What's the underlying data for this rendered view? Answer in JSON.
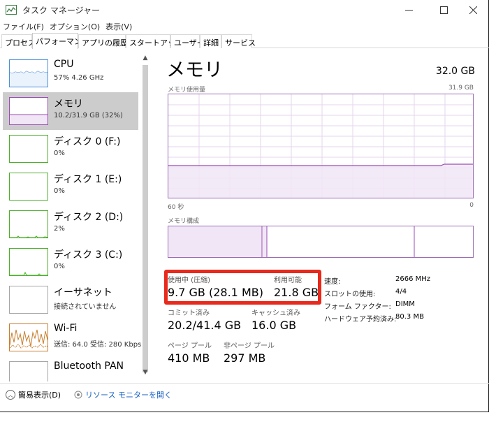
{
  "title_bar": {
    "title": "タスク マネージャー"
  },
  "menu": [
    "ファイル(F)",
    "オプション(O)",
    "表示(V)"
  ],
  "tabs": [
    "プロセス",
    "パフォーマンス",
    "アプリの履歴",
    "スタートアップ",
    "ユーザー",
    "詳細",
    "サービス"
  ],
  "active_tab": "パフォーマンス",
  "sidebar": {
    "items": [
      {
        "name": "CPU",
        "sub": "57%  4.26 GHz",
        "color": "#4a90d9"
      },
      {
        "name": "メモリ",
        "sub": "10.2/31.9 GB (32%)",
        "color": "#9b4db5"
      },
      {
        "name": "ディスク 0 (F:)",
        "sub": "0%",
        "color": "#4caf2a"
      },
      {
        "name": "ディスク 1 (E:)",
        "sub": "0%",
        "color": "#4caf2a"
      },
      {
        "name": "ディスク 2 (D:)",
        "sub": "2%",
        "color": "#4caf2a"
      },
      {
        "name": "ディスク 3 (C:)",
        "sub": "0%",
        "color": "#4caf2a"
      },
      {
        "name": "イーサネット",
        "sub": "接続されていません",
        "color": "#a6a6a6"
      },
      {
        "name": "Wi-Fi",
        "sub": "送信: 64.0  受信: 280 Kbps",
        "color": "#c87e2e"
      },
      {
        "name": "Bluetooth PAN",
        "sub": "",
        "color": "#a6a6a6"
      }
    ]
  },
  "memory": {
    "title": "メモリ",
    "total": "32.0 GB",
    "usage_label": "メモリ使用量",
    "usage_max": "31.9 GB",
    "time_left": "60 秒",
    "time_right": "0",
    "composition_label": "メモリ構成",
    "in_use_label": "使用中 (圧縮)",
    "in_use_value": "9.7 GB (28.1 MB)",
    "available_label": "利用可能",
    "available_value": "21.8 GB",
    "committed_label": "コミット済み",
    "committed_value": "20.2/41.4 GB",
    "cached_label": "キャッシュ済み",
    "cached_value": "16.0 GB",
    "paged_label": "ページ プール",
    "paged_value": "410 MB",
    "nonpaged_label": "非ページ プール",
    "nonpaged_value": "297 MB",
    "speed_label": "速度:",
    "speed_value": "2666 MHz",
    "slots_label": "スロットの使用:",
    "slots_value": "4/4",
    "form_label": "フォーム ファクター:",
    "form_value": "DIMM",
    "reserved_label": "ハードウェア予約済み:",
    "reserved_value": "80.3 MB"
  },
  "footer": {
    "fewer_details": "簡易表示(D)",
    "resource_monitor": "リソース モニターを開く"
  },
  "colors": {
    "memory_accent": "#9b4db5",
    "highlight_box": "#e8291c",
    "link": "#1460c4"
  }
}
